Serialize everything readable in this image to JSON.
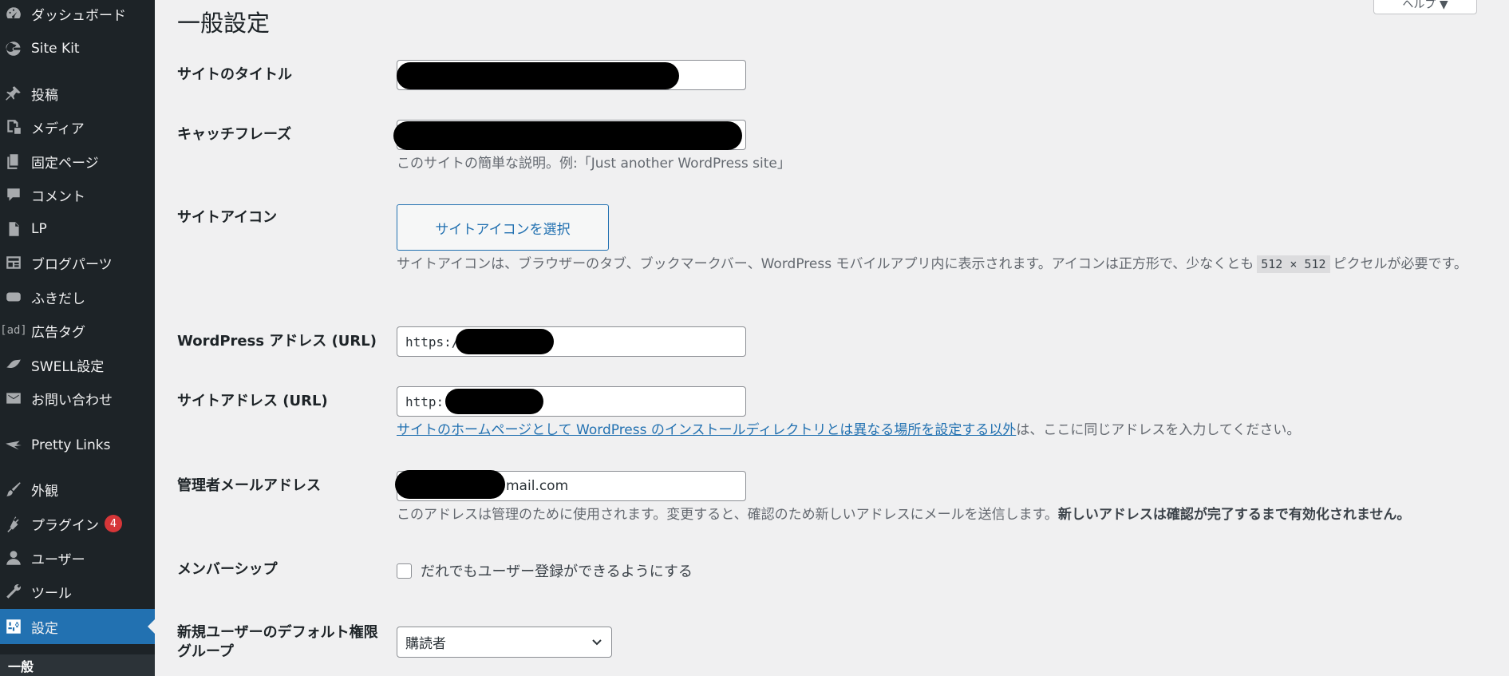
{
  "sidebar": {
    "items": [
      {
        "label": "ダッシュボード",
        "icon": "dashboard-icon"
      },
      {
        "label": "Site Kit",
        "icon": "google-g-icon"
      },
      {
        "label": "投稿",
        "icon": "pin-icon"
      },
      {
        "label": "メディア",
        "icon": "media-icon"
      },
      {
        "label": "固定ページ",
        "icon": "page-icon"
      },
      {
        "label": "コメント",
        "icon": "comment-icon"
      },
      {
        "label": "LP",
        "icon": "document-icon"
      },
      {
        "label": "ブログパーツ",
        "icon": "layout-icon"
      },
      {
        "label": "ふきだし",
        "icon": "speech-bubble-icon"
      },
      {
        "label": "広告タグ",
        "icon": "ad-icon",
        "icon_text": "[ad]"
      },
      {
        "label": "SWELL設定",
        "icon": "bird-icon"
      },
      {
        "label": "お問い合わせ",
        "icon": "mail-icon"
      },
      {
        "label": "Pretty Links",
        "icon": "pretty-links-icon"
      },
      {
        "label": "外観",
        "icon": "brush-icon"
      },
      {
        "label": "プラグイン",
        "icon": "plugin-icon",
        "badge": "4"
      },
      {
        "label": "ユーザー",
        "icon": "user-icon"
      },
      {
        "label": "ツール",
        "icon": "wrench-icon"
      },
      {
        "label": "設定",
        "icon": "settings-icon",
        "active": true
      }
    ],
    "submenu_current": "一般"
  },
  "header": {
    "title": "一般設定",
    "help_label": "ヘルプ ▼"
  },
  "form": {
    "site_title": {
      "label": "サイトのタイトル",
      "value": ""
    },
    "tagline": {
      "label": "キャッチフレーズ",
      "value": "",
      "description": "このサイトの簡単な説明。例:「Just another WordPress site」"
    },
    "site_icon": {
      "label": "サイトアイコン",
      "button_label": "サイトアイコンを選択",
      "description_before": "サイトアイコンは、ブラウザーのタブ、ブックマークバー、WordPress モバイルアプリ内に表示されます。アイコンは正方形で、少なくとも",
      "description_code": "512 × 512",
      "description_after": "ピクセルが必要です。"
    },
    "wp_address": {
      "label": "WordPress アドレス (URL)",
      "value": "https:/"
    },
    "site_address": {
      "label": "サイトアドレス (URL)",
      "value": "http:",
      "description_link": "サイトのホームページとして WordPress のインストールディレクトリとは異なる場所を設定する以外",
      "description_after": "は、ここに同じアドレスを入力してください。"
    },
    "admin_email": {
      "label": "管理者メールアドレス",
      "value": "mail.com",
      "description": "このアドレスは管理のために使用されます。変更すると、確認のため新しいアドレスにメールを送信します。",
      "description_strong": "新しいアドレスは確認が完了するまで有効化されません。"
    },
    "membership": {
      "label": "メンバーシップ",
      "checkbox_label": "だれでもユーザー登録ができるようにする",
      "checked": false
    },
    "default_role": {
      "label": "新規ユーザーのデフォルト権限グループ",
      "value": "購読者"
    }
  },
  "colors": {
    "sidebar_bg": "#1d2327",
    "accent": "#2271b1",
    "badge": "#d63638",
    "page_bg": "#f0f0f1"
  }
}
